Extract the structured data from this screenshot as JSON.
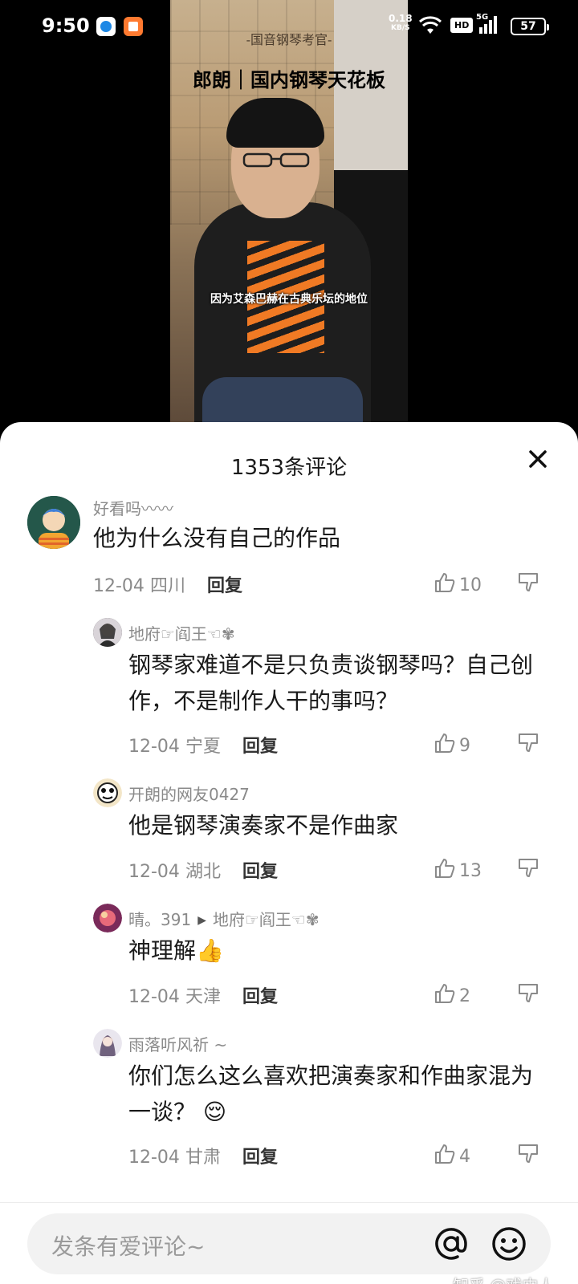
{
  "status_bar": {
    "time": "9:50",
    "net_speed_value": "0.18",
    "net_speed_unit": "KB/S",
    "hd": "HD",
    "network": "5G",
    "battery": "57"
  },
  "video": {
    "caption_top": "-国音钢琴考官-",
    "title": "郎朗｜国内钢琴天花板",
    "subtitle": "因为艾森巴赫在古典乐坛的地位"
  },
  "sheet": {
    "title": "1353条评论"
  },
  "comments": [
    {
      "user": "好看吗〰〰",
      "text": "他为什么没有自己的作品",
      "date": "12-04",
      "region": "四川",
      "reply": "回复",
      "likes": "10"
    },
    {
      "user": "地府☞阎王☜✾",
      "text": "钢琴家难道不是只负责谈钢琴吗？自己创作，不是制作人干的事吗？",
      "date": "12-04",
      "region": "宁夏",
      "reply": "回复",
      "likes": "9"
    },
    {
      "user": "开朗的网友0427",
      "text": "他是钢琴演奏家不是作曲家",
      "date": "12-04",
      "region": "湖北",
      "reply": "回复",
      "likes": "13"
    },
    {
      "user": "晴。391",
      "reply_to": "地府☞阎王☜✾",
      "text": "神理解👍",
      "date": "12-04",
      "region": "天津",
      "reply": "回复",
      "likes": "2"
    },
    {
      "user": "雨落听风祈 ~",
      "text": "你们怎么这么喜欢把演奏家和作曲家混为一谈？ 😌",
      "date": "12-04",
      "region": "甘肃",
      "reply": "回复",
      "likes": "4"
    }
  ],
  "input": {
    "placeholder": "发条有爱评论~"
  },
  "watermark": "知乎 @戏中人",
  "colors": {
    "accent_text": "#1a1a1a",
    "muted_text": "#8a8a8a",
    "input_bg": "#f2f2f2"
  }
}
